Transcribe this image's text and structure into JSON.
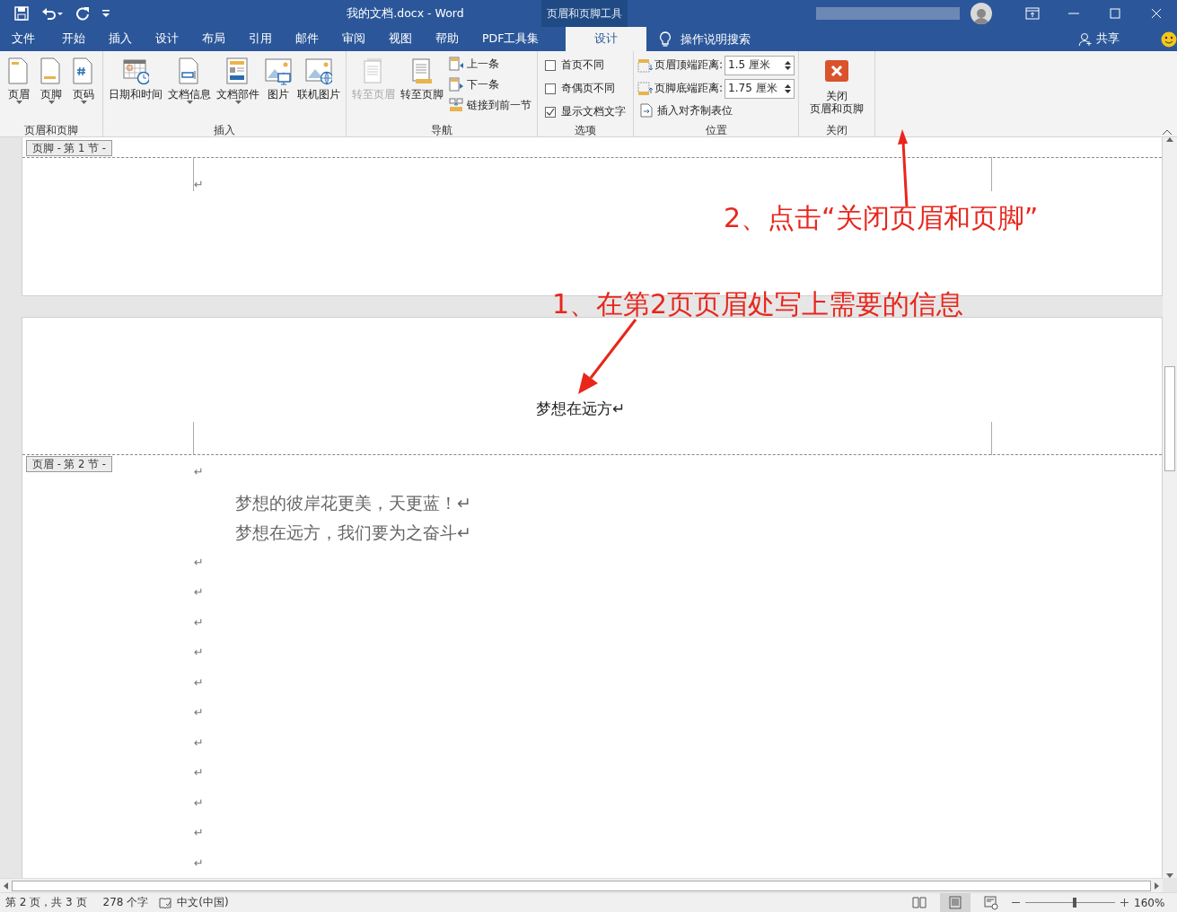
{
  "title_bar": {
    "title": "我的文档.docx  -  Word",
    "context_label": "页眉和页脚工具"
  },
  "menu_tabs": [
    {
      "label": "文件",
      "selected": false
    },
    {
      "label": "开始",
      "selected": false
    },
    {
      "label": "插入",
      "selected": false
    },
    {
      "label": "设计",
      "selected": false
    },
    {
      "label": "布局",
      "selected": false
    },
    {
      "label": "引用",
      "selected": false
    },
    {
      "label": "邮件",
      "selected": false
    },
    {
      "label": "审阅",
      "selected": false
    },
    {
      "label": "视图",
      "selected": false
    },
    {
      "label": "帮助",
      "selected": false
    },
    {
      "label": "PDF工具集",
      "selected": false
    },
    {
      "label": "设计",
      "selected": true
    }
  ],
  "search": {
    "placeholder": "操作说明搜索"
  },
  "share": "共享",
  "ribbon_groups": [
    {
      "label": "页眉和页脚",
      "items": [
        {
          "kind": "large",
          "label": "页眉",
          "dropdown": true,
          "disabled": false
        },
        {
          "kind": "large",
          "label": "页脚",
          "dropdown": true,
          "disabled": false
        },
        {
          "kind": "large",
          "label": "页码",
          "dropdown": true,
          "disabled": false
        }
      ]
    },
    {
      "label": "插入",
      "items": [
        {
          "kind": "large",
          "label": "日期和时间",
          "dropdown": false,
          "disabled": false
        },
        {
          "kind": "large",
          "label": "文档信息",
          "dropdown": true,
          "disabled": false
        },
        {
          "kind": "large",
          "label": "文档部件",
          "dropdown": true,
          "disabled": false
        },
        {
          "kind": "large",
          "label": "图片",
          "dropdown": false,
          "disabled": false
        },
        {
          "kind": "large",
          "label": "联机图片",
          "dropdown": false,
          "disabled": false
        }
      ]
    },
    {
      "label": "导航",
      "items": [
        {
          "kind": "large",
          "label": "转至页眉",
          "dropdown": false,
          "disabled": true
        },
        {
          "kind": "large",
          "label": "转至页脚",
          "dropdown": false,
          "disabled": false
        },
        {
          "kind": "small",
          "label": "上一条",
          "disabled": false
        },
        {
          "kind": "small",
          "label": "下一条",
          "disabled": false
        },
        {
          "kind": "small",
          "label": "链接到前一节",
          "disabled": false
        }
      ]
    },
    {
      "label": "选项",
      "items": [
        {
          "kind": "checkbox",
          "label": "首页不同",
          "checked": false
        },
        {
          "kind": "checkbox",
          "label": "奇偶页不同",
          "checked": false
        },
        {
          "kind": "checkbox",
          "label": "显示文档文字",
          "checked": true
        }
      ]
    },
    {
      "label": "位置",
      "items": [
        {
          "kind": "spinner",
          "label": "页眉顶端距离:",
          "value": "1.5 厘米"
        },
        {
          "kind": "spinner",
          "label": "页脚底端距离:",
          "value": "1.75 厘米"
        },
        {
          "kind": "small",
          "label": "插入对齐制表位",
          "disabled": false
        }
      ]
    },
    {
      "label": "关闭",
      "items": [
        {
          "kind": "close",
          "lines": [
            "关闭",
            "页眉和页脚"
          ],
          "disabled": false
        }
      ]
    }
  ],
  "document": {
    "footer_tag": "页脚 - 第 1 节 -",
    "footer_lines": [
      "↵"
    ],
    "header_text": "梦想在远方↵",
    "header_tag": "页眉 - 第 2 节 -",
    "body_lines": [
      {
        "kind": "mark",
        "text": "↵"
      },
      {
        "kind": "text",
        "text": "梦想的彼岸花更美，天更蓝！↵"
      },
      {
        "kind": "text",
        "text": "梦想在远方，我们要为之奋斗↵"
      },
      {
        "kind": "mark",
        "text": "↵"
      },
      {
        "kind": "mark",
        "text": "↵"
      },
      {
        "kind": "mark",
        "text": "↵"
      },
      {
        "kind": "mark",
        "text": "↵"
      },
      {
        "kind": "mark",
        "text": "↵"
      },
      {
        "kind": "mark",
        "text": "↵"
      },
      {
        "kind": "mark",
        "text": "↵"
      },
      {
        "kind": "mark",
        "text": "↵"
      },
      {
        "kind": "mark",
        "text": "↵"
      },
      {
        "kind": "mark",
        "text": "↵"
      },
      {
        "kind": "mark",
        "text": "↵"
      }
    ]
  },
  "annotations": [
    {
      "text": "2、点击“关闭页眉和页脚”"
    },
    {
      "text": "1、在第2页页眉处写上需要的信息"
    }
  ],
  "status_bar": {
    "items": [
      "第 2 页，共 3 页",
      "278 个字",
      "中文(中国)"
    ],
    "views": [
      {
        "selected": false
      },
      {
        "selected": true
      },
      {
        "selected": false
      }
    ],
    "zoom": {
      "level": 0.55,
      "reading": "160%"
    }
  }
}
